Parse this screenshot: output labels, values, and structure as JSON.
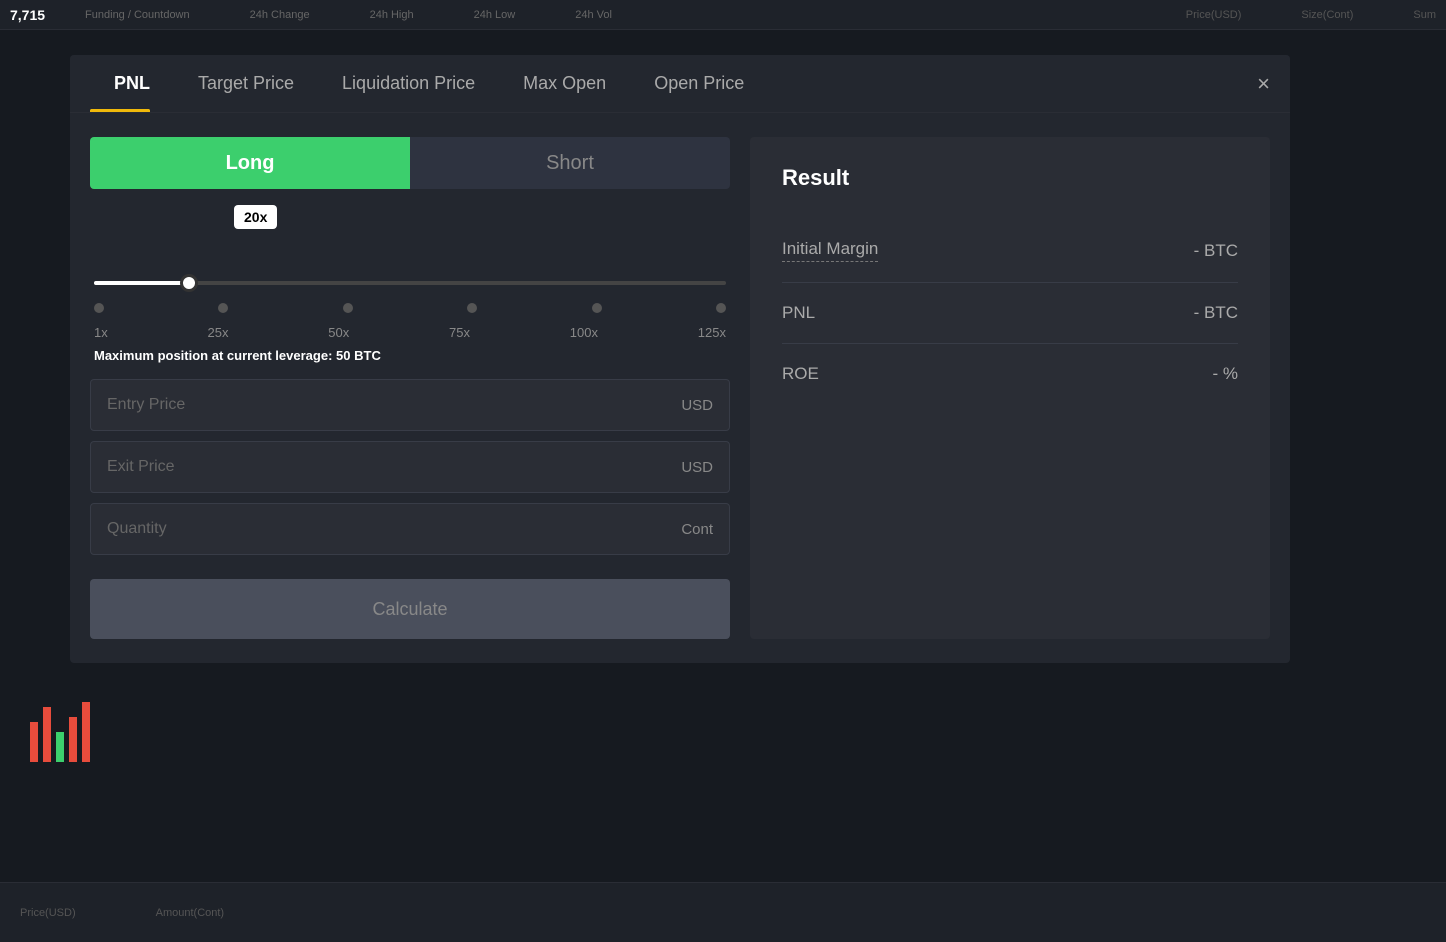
{
  "topbar": {
    "price": "7,715",
    "columns": [
      "Funding / Countdown",
      "24h Change",
      "24h High",
      "24h Low",
      "24h Vol"
    ]
  },
  "rightCols": {
    "col1": "Price(USD)",
    "col2": "Size(Cont)",
    "col3": "Sum"
  },
  "bottomBar": {
    "col1": "Price(USD)",
    "col2": "Amount(Cont)"
  },
  "modal": {
    "tabs": [
      {
        "id": "pnl",
        "label": "PNL",
        "active": true
      },
      {
        "id": "target-price",
        "label": "Target Price",
        "active": false
      },
      {
        "id": "liquidation-price",
        "label": "Liquidation Price",
        "active": false
      },
      {
        "id": "max-open",
        "label": "Max Open",
        "active": false
      },
      {
        "id": "open-price",
        "label": "Open Price",
        "active": false
      }
    ],
    "close_label": "×",
    "toggle": {
      "long_label": "Long",
      "short_label": "Short",
      "active": "long"
    },
    "leverage": {
      "tooltip": "20x",
      "labels": [
        "1x",
        "25x",
        "50x",
        "75x",
        "100x",
        "125x"
      ],
      "current": 20
    },
    "max_position_prefix": "Maximum position at current leverage:",
    "max_position_value": "50",
    "max_position_unit": "BTC",
    "inputs": [
      {
        "id": "entry-price",
        "placeholder": "Entry Price",
        "unit": "USD"
      },
      {
        "id": "exit-price",
        "placeholder": "Exit Price",
        "unit": "USD"
      },
      {
        "id": "quantity",
        "placeholder": "Quantity",
        "unit": "Cont"
      }
    ],
    "calculate_label": "Calculate",
    "result": {
      "title": "Result",
      "rows": [
        {
          "label": "Initial Margin",
          "label_underline": true,
          "value": "- BTC"
        },
        {
          "label": "PNL",
          "label_underline": false,
          "value": "- BTC"
        },
        {
          "label": "ROE",
          "label_underline": false,
          "value": "- %"
        }
      ]
    }
  }
}
